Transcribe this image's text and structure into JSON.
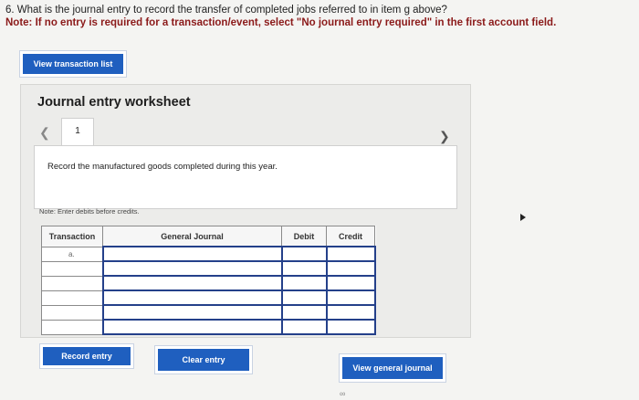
{
  "question": {
    "text": "6. What is the journal entry to record the transfer of completed jobs referred to in item g above?",
    "note": "Note: If no entry is required for a transaction/event, select \"No journal entry required\" in the first account field."
  },
  "buttons": {
    "view_transaction_list": "View transaction list",
    "record_entry": "Record entry",
    "clear_entry": "Clear entry",
    "view_general_journal": "View general journal"
  },
  "worksheet": {
    "title": "Journal entry worksheet",
    "tab_number": "1",
    "description": "Record the manufactured goods completed during this year.",
    "note": "Note: Enter debits before credits.",
    "table": {
      "headers": [
        "Transaction",
        "General Journal",
        "Debit",
        "Credit"
      ],
      "first_transaction": "a."
    }
  },
  "icons": [
    "chevron-left-icon",
    "chevron-right-icon",
    "cursor-arrow-icon",
    "link-icon"
  ]
}
